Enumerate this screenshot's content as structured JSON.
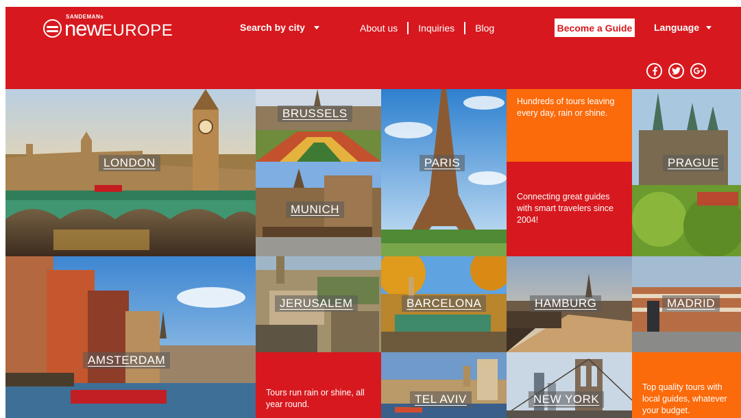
{
  "header": {
    "logo": {
      "small": "SANDEMANs",
      "new": "new",
      "europe": "EUROPE"
    },
    "search_by_city": "Search by city",
    "nav_links": [
      "About us",
      "Inquiries",
      "Blog"
    ],
    "become_guide": "Become a Guide",
    "language": "Language",
    "social": [
      {
        "icon": "facebook-icon",
        "glyph": "f"
      },
      {
        "icon": "twitter-icon",
        "glyph": "t"
      },
      {
        "icon": "googleplus-icon",
        "glyph": "g+"
      }
    ]
  },
  "cities": {
    "london": "LONDON",
    "brussels": "BRUSSELS",
    "munich": "MUNICH",
    "paris": "PARIS",
    "prague": "PRAGUE",
    "amsterdam": "AMSTERDAM",
    "jerusalem": "JERUSALEM",
    "barcelona": "BARCELONA",
    "hamburg": "HAMBURG",
    "madrid": "MADRID",
    "tel_aviv": "TEL AVIV",
    "new_york": "NEW YORK"
  },
  "info_tiles": {
    "hundreds": "Hundreds of tours leaving every day, rain or shine.",
    "connecting": "Connecting great guides with smart travelers since 2004!",
    "rain_or_shine": "Tours run rain or shine, all year round.",
    "quality": "Top quality tours with local guides, whatever your budget."
  },
  "colors": {
    "brand_red": "#d7191f",
    "orange": "#fb6a0b",
    "white": "#ffffff"
  }
}
